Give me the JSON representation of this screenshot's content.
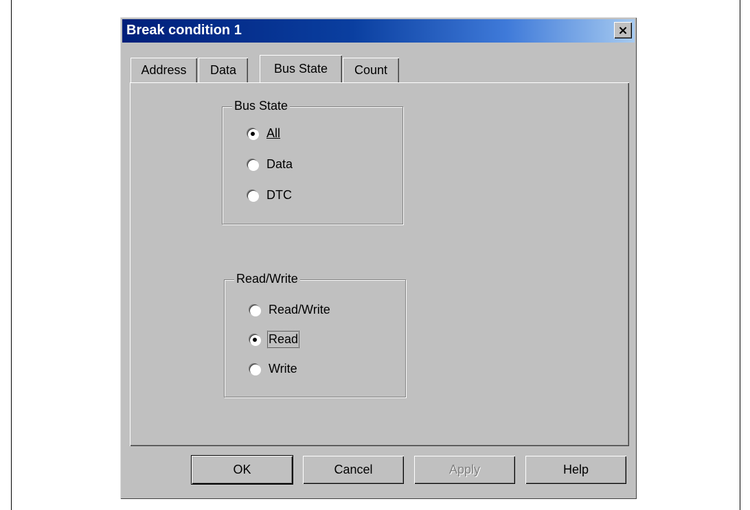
{
  "dialog": {
    "title": "Break condition 1",
    "close_label": "×"
  },
  "tabs": [
    {
      "label": "Address",
      "active": false
    },
    {
      "label": "Data",
      "active": false
    },
    {
      "label": "Bus State",
      "active": true
    },
    {
      "label": "Count",
      "active": false
    }
  ],
  "bus_state_group": {
    "legend": "Bus State",
    "options": [
      {
        "label": "All",
        "checked": true
      },
      {
        "label": "Data",
        "checked": false
      },
      {
        "label": "DTC",
        "checked": false
      }
    ]
  },
  "read_write_group": {
    "legend": "Read/Write",
    "options": [
      {
        "label": "Read/Write",
        "checked": false
      },
      {
        "label": "Read",
        "checked": true
      },
      {
        "label": "Write",
        "checked": false
      }
    ]
  },
  "buttons": {
    "ok": "OK",
    "cancel": "Cancel",
    "apply": "Apply",
    "help": "Help"
  }
}
